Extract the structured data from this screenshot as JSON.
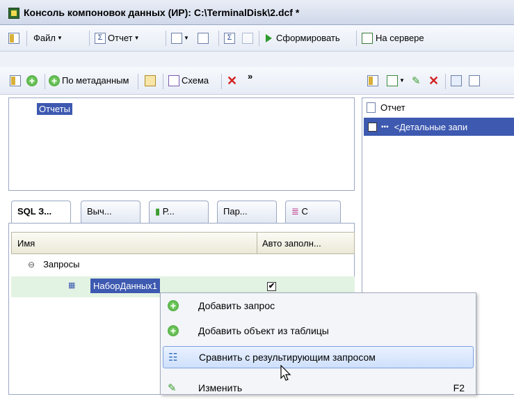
{
  "window": {
    "title": "Консоль компоновок данных (ИР): C:\\TerminalDisk\\2.dcf *"
  },
  "toolbar_main": {
    "file_label": "Файл",
    "report_label": "Отчет",
    "run_label": "Сформировать",
    "server_label": "На сервере"
  },
  "toolbar_left": {
    "by_metadata_label": "По метаданным",
    "schema_label": "Схема",
    "more_label": "»"
  },
  "reports_tree": {
    "item": "Отчеты"
  },
  "right_tree": {
    "root": "Отчет",
    "child": "<Детальные запи"
  },
  "tabs": [
    {
      "label": "SQL З..."
    },
    {
      "label": "Выч..."
    },
    {
      "label": "Р..."
    },
    {
      "label": "Пар..."
    },
    {
      "label": "С"
    }
  ],
  "queries_grid": {
    "col_name": "Имя",
    "col_auto": "Авто заполн...",
    "group": "Запросы",
    "row": "НаборДанных1"
  },
  "context_menu": {
    "items": [
      {
        "label": "Добавить запрос",
        "key": ""
      },
      {
        "label": "Добавить объект из таблицы",
        "key": ""
      },
      {
        "label": "Сравнить с результирующим запросом",
        "key": ""
      },
      {
        "label": "Изменить",
        "key": "F2"
      }
    ]
  }
}
